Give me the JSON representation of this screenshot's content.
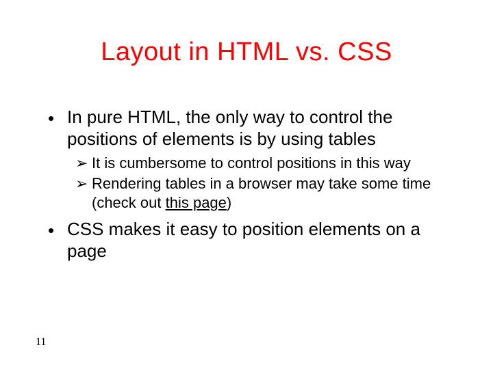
{
  "slide": {
    "title": "Layout in HTML vs. CSS",
    "bullets": [
      {
        "text": "In pure HTML, the only way to control the positions of elements is by using tables",
        "sub": [
          {
            "text": "It is cumbersome to control positions in this way"
          },
          {
            "pre": "Rendering tables in a browser may take some time (check out ",
            "link": "this page",
            "post": ")"
          }
        ]
      },
      {
        "text": "CSS makes it easy to position elements on a page"
      }
    ],
    "page_number": "11"
  },
  "markers": {
    "l1": "•",
    "l2": "➢"
  }
}
